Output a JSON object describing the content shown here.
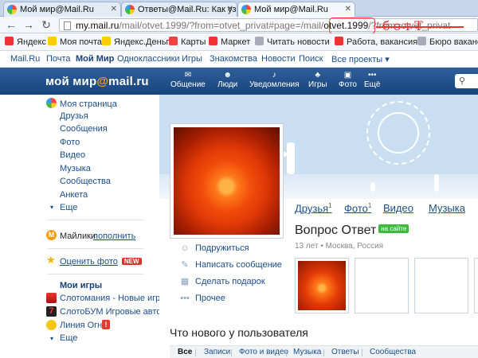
{
  "browser": {
    "tabs": [
      {
        "title": "Мой мир@Mail.Ru"
      },
      {
        "title": "Ответы@Mail.Ru: Как узна"
      },
      {
        "title": "Мой мир@Mail.Ru"
      }
    ],
    "url_host": "my.mail.ru",
    "url_path": "/mail/otvet.1999/?from=otvet_privat#page=/mail/",
    "url_highlight": "otvet.1999",
    "url_tail": "/?from=otvet_privat",
    "scribble": "ботТ",
    "annotation_color": "#e33333"
  },
  "bookmarks": [
    "Яндекс",
    "Моя почта",
    "Яндекс.Деньги",
    "Карты",
    "Маркет",
    "Читать новости",
    "Работа, вакансия Р",
    "Бюро вакансий"
  ],
  "portal_nav": [
    "Mail.Ru",
    "Почта",
    "Мой Мир",
    "Одноклассники",
    "Игры",
    "Знакомства",
    "Новости",
    "Поиск",
    "Все проекты ▾"
  ],
  "header": {
    "logo_pre": "мой мир",
    "logo_at": "@",
    "logo_post": "mail.ru",
    "nav": [
      {
        "label": "Общение",
        "icon": "chat-icon"
      },
      {
        "label": "Люди",
        "icon": "people-icon"
      },
      {
        "label": "Уведомления",
        "icon": "bell-icon"
      },
      {
        "label": "Игры",
        "icon": "gamepad-icon"
      },
      {
        "label": "Фото",
        "icon": "camera-icon"
      },
      {
        "label": "Ещё",
        "icon": "more-icon"
      }
    ]
  },
  "sidebar": {
    "my_page": "Моя страница",
    "links": [
      "Друзья",
      "Сообщения",
      "Фото",
      "Видео",
      "Музыка",
      "Сообщества",
      "Анкета"
    ],
    "more": "Еще",
    "mailiki": "Майлики",
    "top_up": "пополнить",
    "rate_photos": "Оценить фото",
    "new_badge": "NEW",
    "games_title": "Мои игры",
    "games": [
      "Слотомания - Новые игр",
      "СлотоБУМ Игровые авто",
      "Линия Огня"
    ],
    "games_more": "Еще"
  },
  "profile": {
    "actions": [
      "Подружиться",
      "Написать сообщение",
      "Сделать подарок",
      "Прочее"
    ],
    "tabs": [
      {
        "label": "Друзья",
        "count": "1"
      },
      {
        "label": "Фото",
        "count": "1"
      },
      {
        "label": "Видео",
        "count": ""
      },
      {
        "label": "Музыка",
        "count": ""
      }
    ],
    "name": "Вопрос Ответ",
    "online_badge": "на сайте",
    "meta": "13 лет • Москва, Россия",
    "whats_new": "Что нового у пользователя",
    "feed_tabs": [
      "Все",
      "Записи",
      "Фото и видео",
      "Музыка",
      "Ответы",
      "Сообщества"
    ]
  }
}
